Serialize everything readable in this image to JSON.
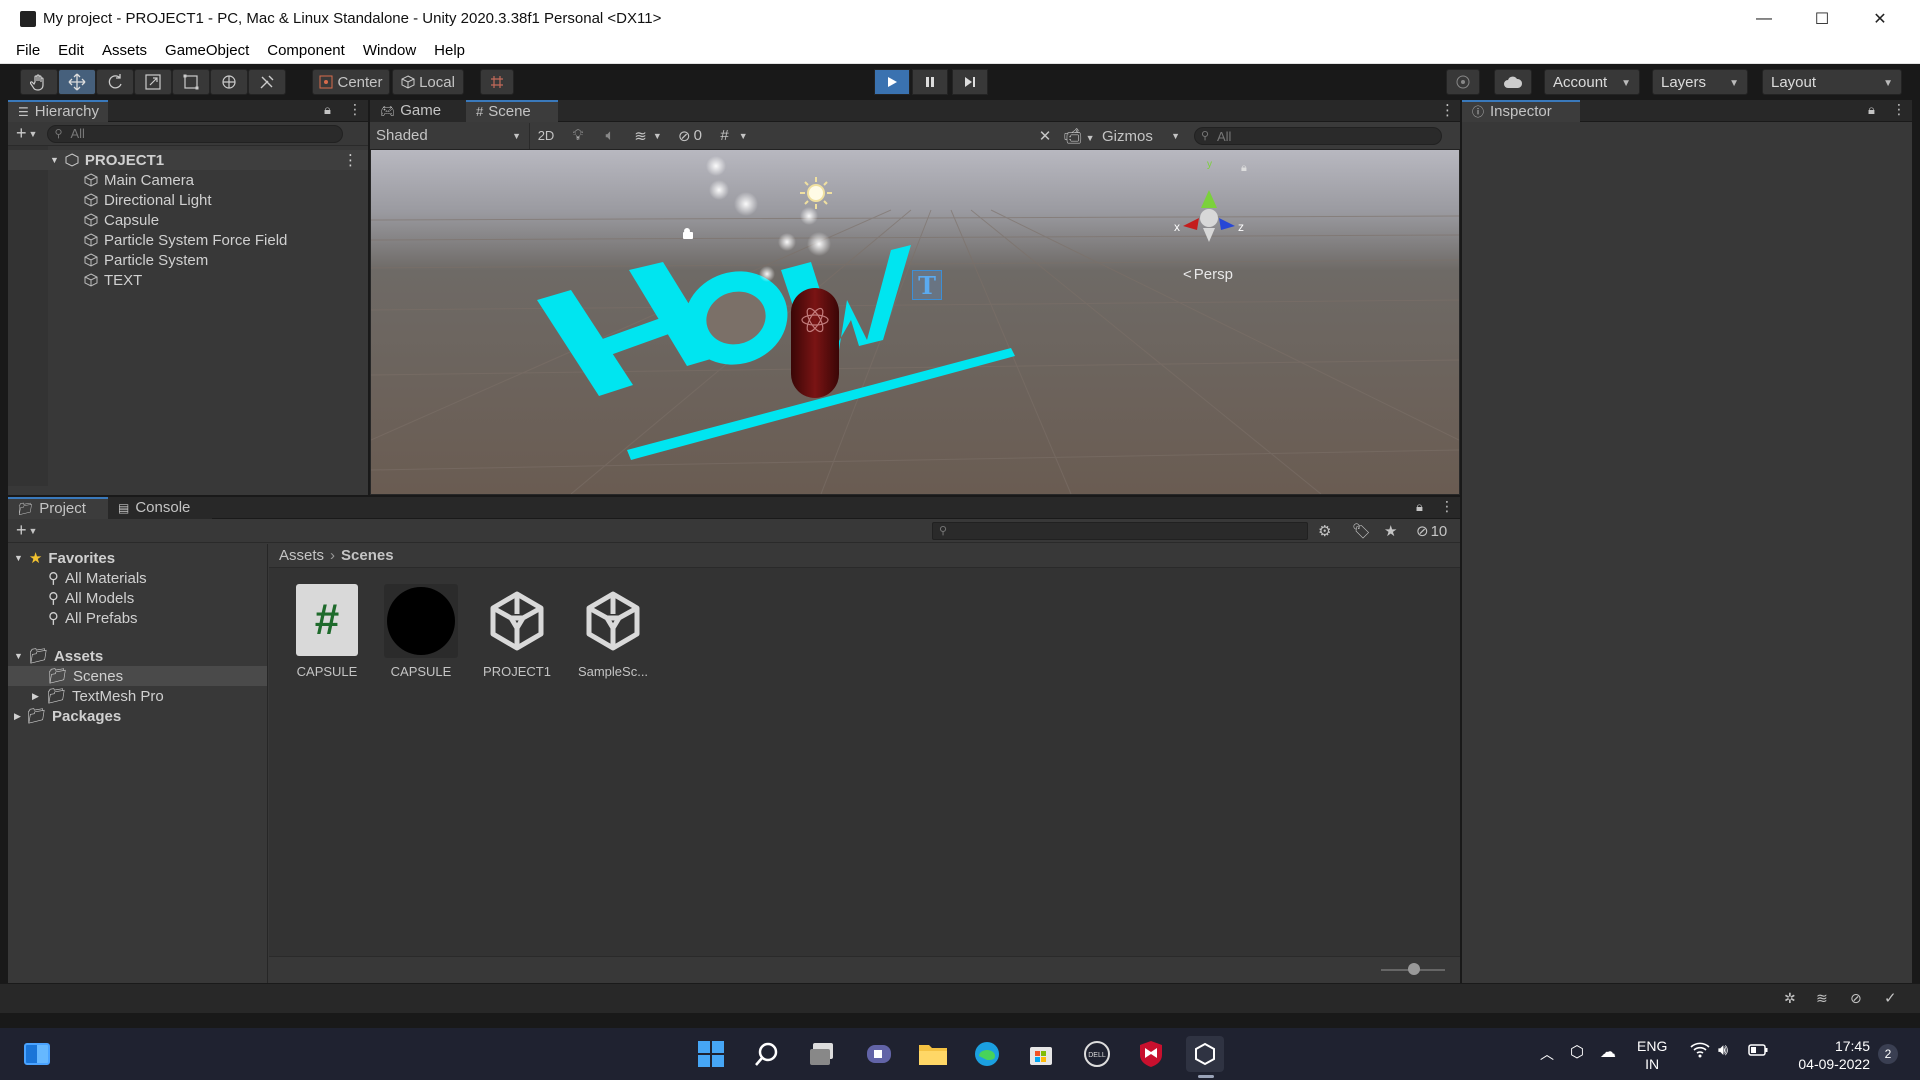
{
  "window": {
    "title": "My project - PROJECT1 - PC, Mac & Linux Standalone - Unity 2020.3.38f1 Personal <DX11>",
    "minimize_glyph": "—",
    "maximize_glyph": "☐",
    "close_glyph": "✕"
  },
  "menu": [
    "File",
    "Edit",
    "Assets",
    "GameObject",
    "Component",
    "Window",
    "Help"
  ],
  "toolbar": {
    "pivot_label": "Center",
    "space_label": "Local",
    "account_label": "Account",
    "layers_label": "Layers",
    "layout_label": "Layout"
  },
  "hierarchy": {
    "tab_label": "Hierarchy",
    "search_placeholder": "All",
    "scene_name": "PROJECT1",
    "items": [
      "Main Camera",
      "Directional Light",
      "Capsule",
      "Particle System Force Field",
      "Particle System",
      "TEXT"
    ]
  },
  "scene_view": {
    "tabs": [
      "Game",
      "Scene"
    ],
    "shading_mode": "Shaded",
    "mode_2d": "2D",
    "hidden_count": "0",
    "gizmos_label": "Gizmos",
    "search_placeholder": "All",
    "text_object": "HOW",
    "persp_label": "Persp",
    "axis_x": "x",
    "axis_y": "y",
    "axis_z": "z",
    "text_gizmo": "T"
  },
  "inspector": {
    "tab_label": "Inspector"
  },
  "project": {
    "tabs": [
      "Project",
      "Console"
    ],
    "hidden_count": "10",
    "breadcrumb": [
      "Assets",
      "Scenes"
    ],
    "favorites_label": "Favorites",
    "favorites": [
      "All Materials",
      "All Models",
      "All Prefabs"
    ],
    "assets_label": "Assets",
    "asset_folders": [
      "Scenes",
      "TextMesh Pro"
    ],
    "packages_label": "Packages",
    "files": [
      {
        "name": "CAPSULE",
        "kind": "script",
        "glyph": "#"
      },
      {
        "name": "CAPSULE",
        "kind": "material"
      },
      {
        "name": "PROJECT1",
        "kind": "scene"
      },
      {
        "name": "SampleSc...",
        "kind": "scene"
      }
    ]
  },
  "taskbar": {
    "language": "ENG",
    "region": "IN",
    "time": "17:45",
    "date": "04-09-2022",
    "notification_count": "2"
  },
  "colors": {
    "accent": "#3a79bb",
    "text_cyan": "#00e5f0",
    "capsule": "#6b1010"
  }
}
